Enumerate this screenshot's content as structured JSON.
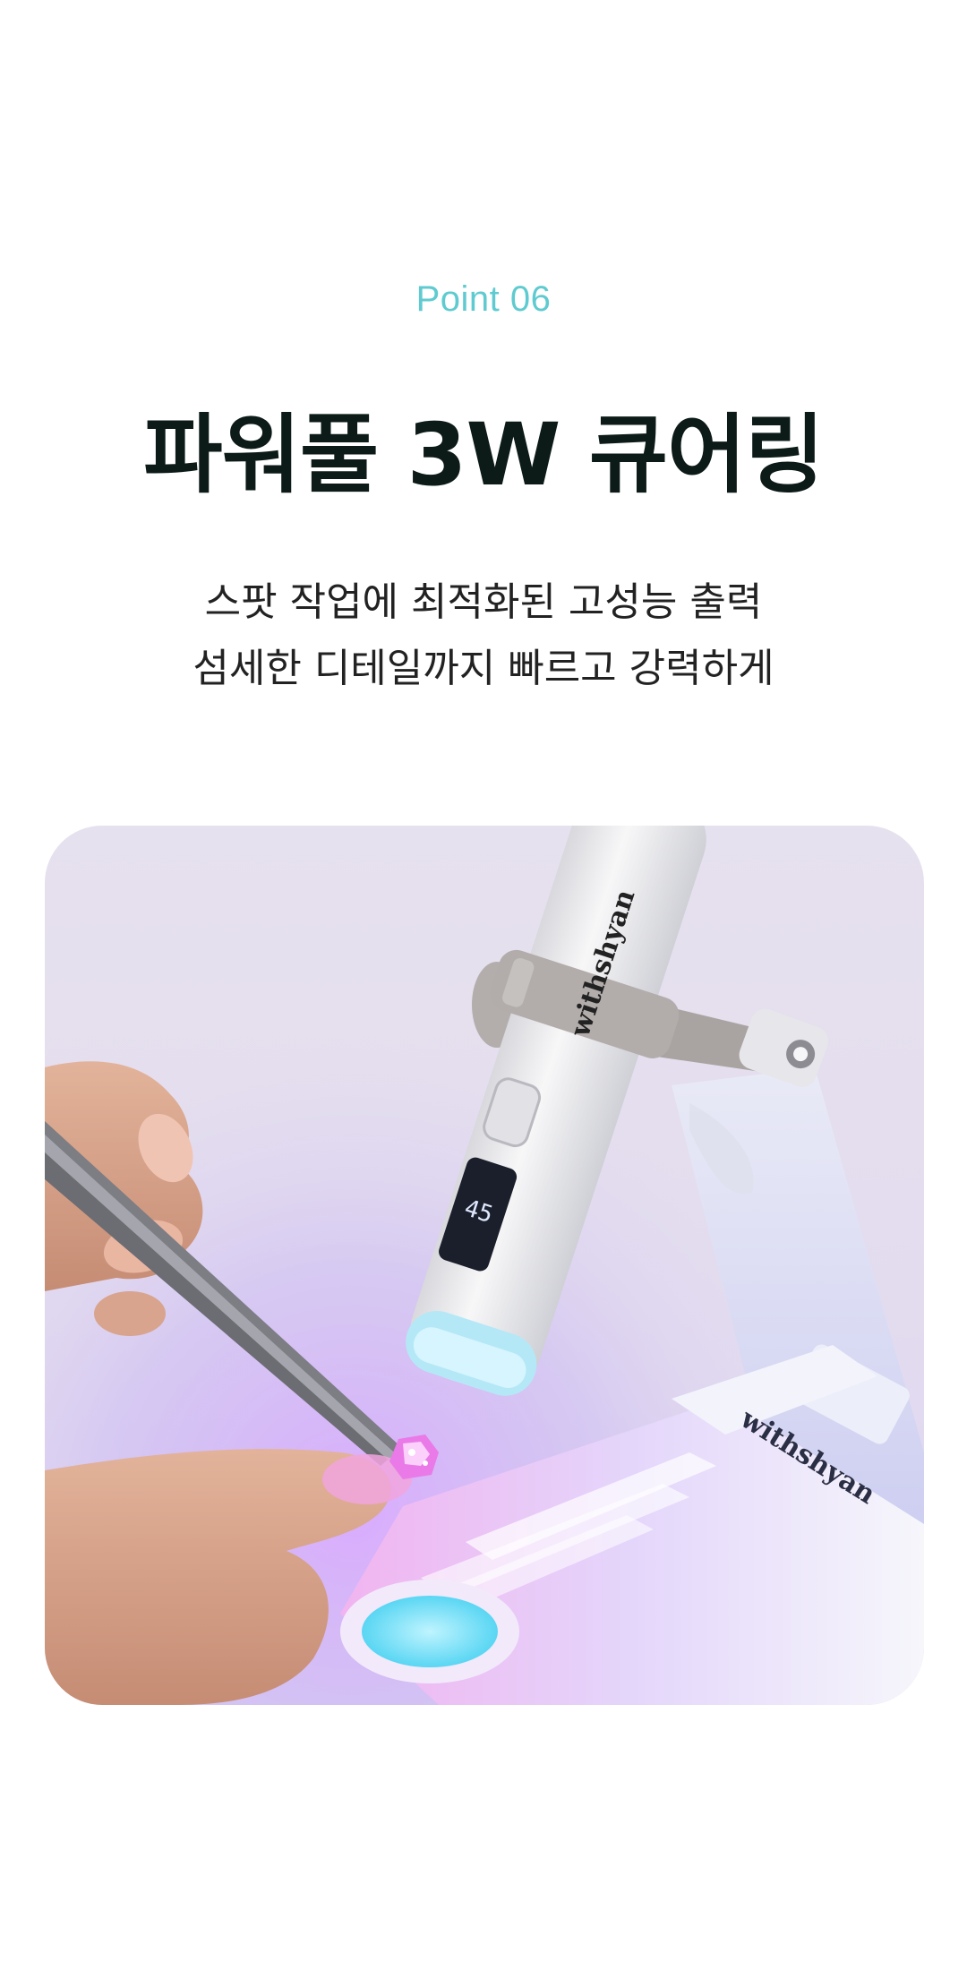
{
  "header": {
    "eyebrow": "Point 06",
    "title": "파워풀 3W 큐어링"
  },
  "description": {
    "line1": "스팟 작업에 최적화된 고성능 출력",
    "line2": "섬세한 디테일까지 빠르고 강력하게"
  },
  "photo": {
    "brand_on_lamp": "withshyan",
    "brand_on_stand": "withshyan"
  },
  "colors": {
    "accent": "#5fcbd0",
    "title": "#0c1b18",
    "uv_glow": "#c08aff"
  }
}
